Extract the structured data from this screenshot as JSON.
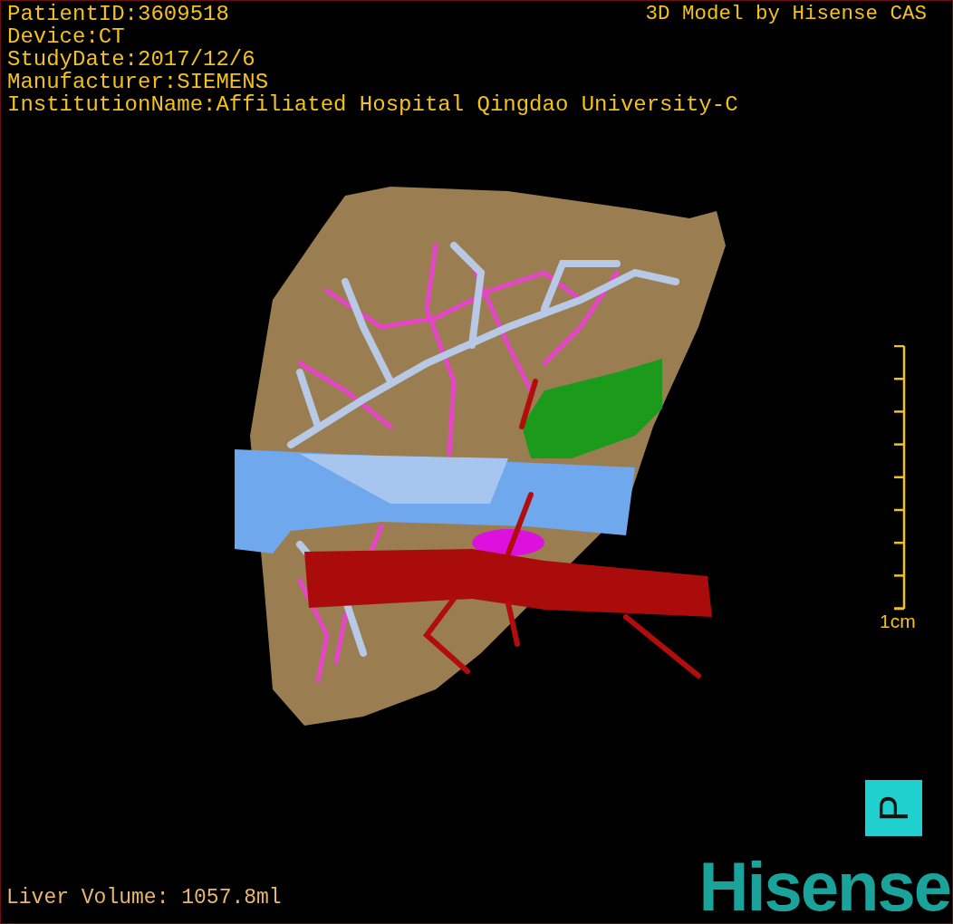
{
  "patient_info": [
    "PatientID:3609518",
    "Device:CT",
    "StudyDate:2017/12/6",
    "Manufacturer:SIEMENS",
    "InstitutionName:Affiliated Hospital Qingdao University-C"
  ],
  "model_credit": "3D Model by Hisense CAS",
  "scale_bar": {
    "label": "1cm"
  },
  "orientation_marker": {
    "label": "P"
  },
  "liver_volume": "Liver Volume: 1057.8ml",
  "logo": "Hisense"
}
